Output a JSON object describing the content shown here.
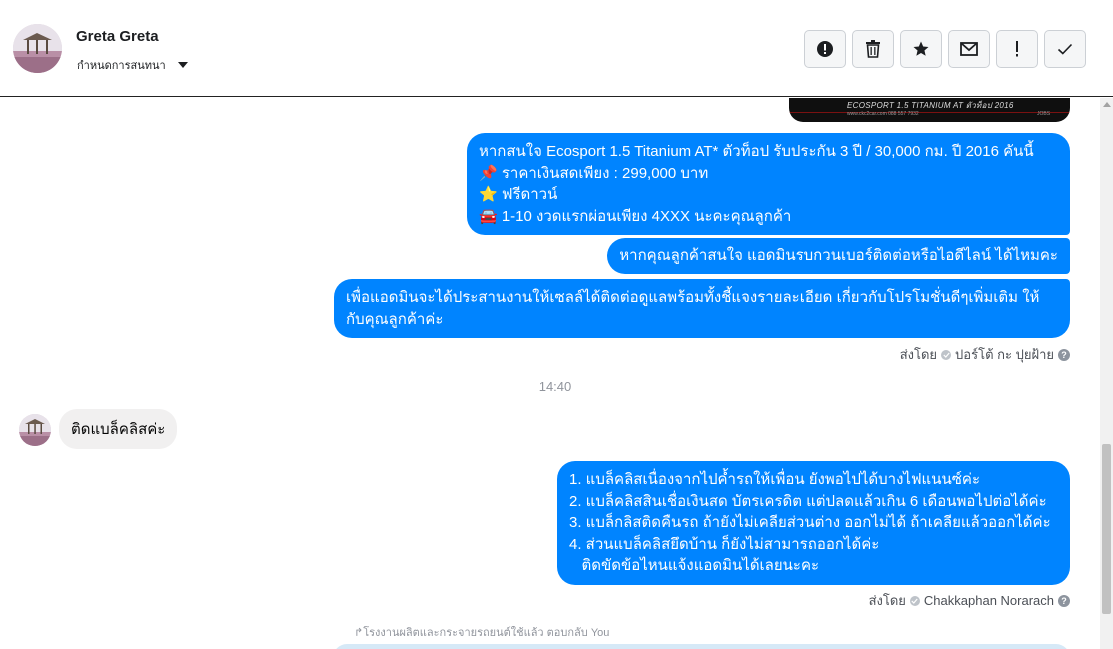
{
  "header": {
    "contact_name": "Greta Greta",
    "assign_label": "กำหนดการสนทนา",
    "toolbar": [
      {
        "name": "spam-button",
        "icon": "alert-circle-icon"
      },
      {
        "name": "delete-button",
        "icon": "trash-icon"
      },
      {
        "name": "star-button",
        "icon": "star-icon"
      },
      {
        "name": "mark-unread-button",
        "icon": "envelope-icon"
      },
      {
        "name": "follow-up-button",
        "icon": "exclamation-icon"
      },
      {
        "name": "mark-done-button",
        "icon": "check-icon"
      }
    ]
  },
  "conversation": {
    "image_caption": "ECOSPORT 1.5 TITANIUM AT ตัวท็อป 2016",
    "image_small_text": "www.ckc2car.com  088 557 7932",
    "image_corner_text": "JOBS",
    "msg1": {
      "l1": "หากสนใจ  Ecosport 1.5 Titanium AT* ตัวท็อป รับประกัน 3 ปี / 30,000 กม. ปี 2016 คันนี้",
      "l2": "📌 ราคาเงินสดเพียง : 299,000 บาท",
      "l3": "⭐ ฟรีดาวน์",
      "l4": "🚘 1-10 งวดแรกผ่อนเพียง 4XXX นะคะคุณลูกค้า"
    },
    "msg2": "หากคุณลูกค้าสนใจ แอดมินรบกวนเบอร์ติดต่อหรือไอดีไลน์ ได้ไหมคะ",
    "msg3": "เพื่อแอดมินจะได้ประสานงานให้เซลล์ได้ติดต่อดูแลพร้อมทั้งชี้แจงรายละเอียด เกี่ยวกับโปรโมชั่นดีๆเพิ่มเติม ให้กับคุณลูกค้าค่ะ",
    "sent_by_1": {
      "prefix": "ส่งโดย",
      "name": "ปอร์โต้ กะ ปุยฝ้าย"
    },
    "timestamp": "14:40",
    "incoming": "ติดแบล็คลิสค่ะ",
    "msg4": {
      "l1": "1. แบล็คลิสเนื่องจากไปค้ำรถให้เพื่อน ยังพอไปได้บางไฟแนนซ์ค่ะ",
      "l2": "2. แบล็คลิสสินเชื่อเงินสด บัตรเครดิต แต่ปลดแล้วเกิน 6 เดือนพอไปต่อได้ค่ะ",
      "l3": "3. แบล็กลิสติดคืนรถ ถ้ายังไม่เคลียส่วนต่าง ออกไม่ได้ ถ้าเคลียแล้วออกได้ค่ะ",
      "l4": "4. ส่วนแบล็คลิสยึดบ้าน ก็ยังไม่สามารถออกได้ค่ะ",
      "l5": "   ติดขัดข้อไหนแจ้งแอดมินได้เลยนะคะ"
    },
    "sent_by_2": {
      "prefix": "ส่งโดย",
      "name": "Chakkaphan Norarach"
    },
    "reply_note": "↱โรงงานผลิตและกระจายรถยนต์ใช้แล้ว ตอบกลับ You"
  },
  "colors": {
    "outgoing_bubble": "#0084ff",
    "incoming_bubble": "#f1f0f0",
    "reply_peek": "#d6e9f7"
  }
}
